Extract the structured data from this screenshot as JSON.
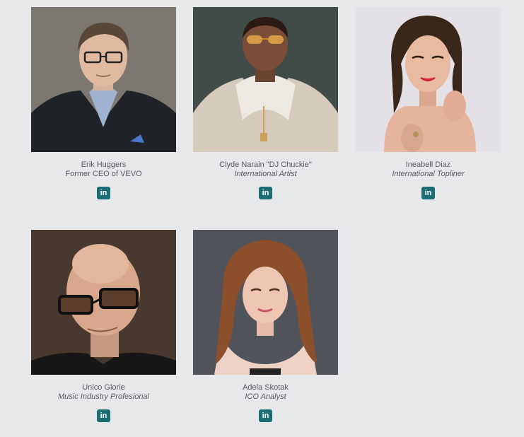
{
  "brand_colors": {
    "linkedin_button": "#1b6e74",
    "background": "#e7e8ea",
    "text": "#555a60"
  },
  "team": [
    {
      "name": "Erik Huggers",
      "role": "Former CEO of VEVO",
      "role_italic": false,
      "social_icon": "linkedin-icon",
      "social_label": "in"
    },
    {
      "name": "Clyde Narain \"DJ Chuckie\"",
      "role": "International Artist",
      "role_italic": true,
      "social_icon": "linkedin-icon",
      "social_label": "in"
    },
    {
      "name": "Ineabell Diaz",
      "role": "International Topliner",
      "role_italic": true,
      "social_icon": "linkedin-icon",
      "social_label": "in"
    },
    {
      "name": "Unico Glorie",
      "role": "Music Industry Profesional",
      "role_italic": true,
      "social_icon": "linkedin-icon",
      "social_label": "in"
    },
    {
      "name": "Adela Skotak",
      "role": "ICO Analyst",
      "role_italic": true,
      "social_icon": "linkedin-icon",
      "social_label": "in"
    }
  ]
}
